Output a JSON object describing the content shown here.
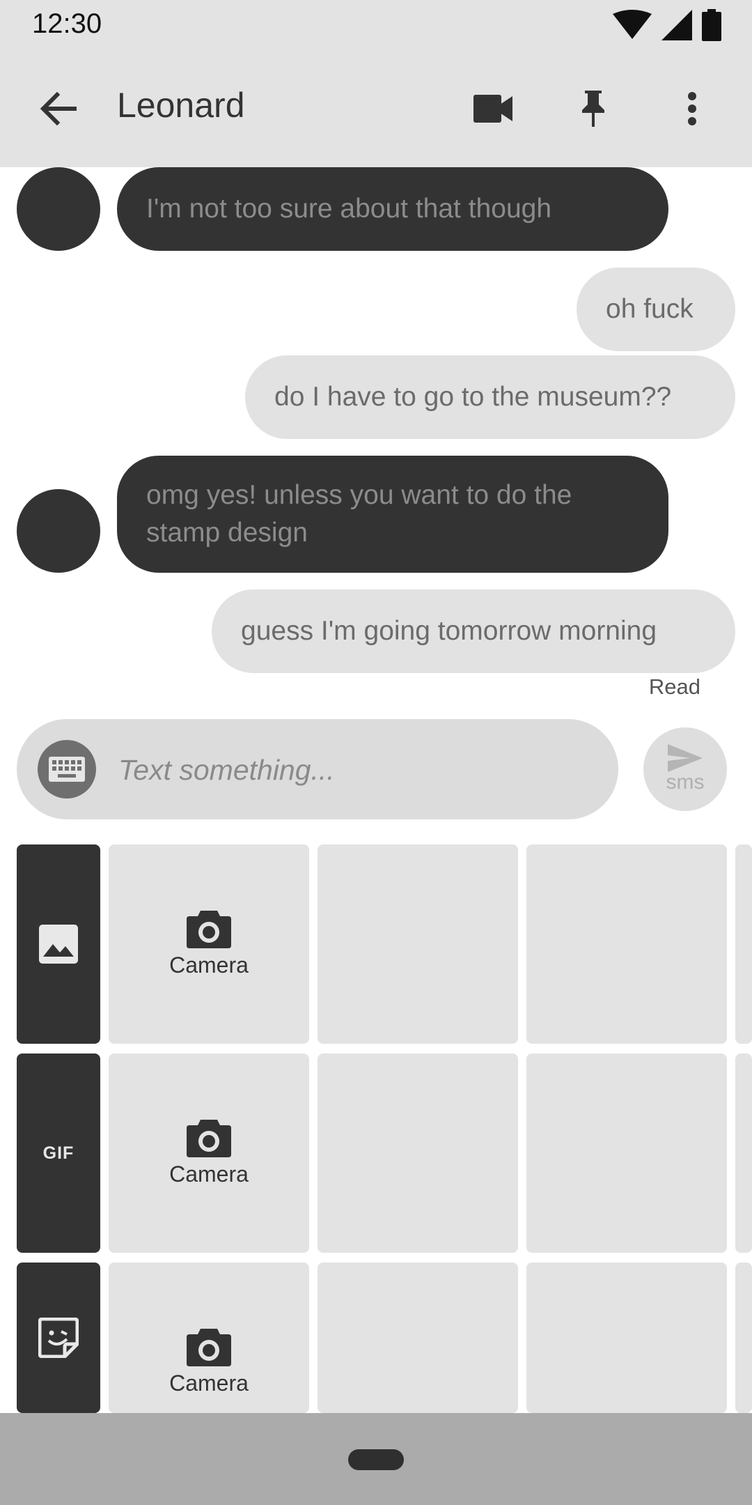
{
  "status_bar": {
    "time": "12:30"
  },
  "app_bar": {
    "title": "Leonard",
    "icons": [
      "back-arrow-icon",
      "video-camera-icon",
      "pin-icon",
      "more-vertical-icon"
    ]
  },
  "messages": [
    {
      "direction": "incoming",
      "text": "I'm not too sure about that though"
    },
    {
      "direction": "outgoing",
      "text": "oh fuck"
    },
    {
      "direction": "outgoing",
      "text": "do I have to go to the museum??"
    },
    {
      "direction": "incoming",
      "text": "omg yes! unless you want to do the stamp design"
    },
    {
      "direction": "outgoing",
      "text": "guess I'm going tomorrow morning"
    }
  ],
  "read_status": "Read",
  "compose": {
    "placeholder": "Text something...",
    "send_label": "sms"
  },
  "media_panel": {
    "tabs": [
      {
        "name": "gallery",
        "icon": "image-icon"
      },
      {
        "name": "gif",
        "label": "GIF"
      },
      {
        "name": "sticker",
        "icon": "sticker-icon"
      }
    ],
    "camera_label": "Camera"
  },
  "colors": {
    "bar_bg": "#e3e3e3",
    "incoming_bubble": "#333333",
    "outgoing_bubble": "#e2e2e2",
    "nav_bar": "#ababab"
  }
}
